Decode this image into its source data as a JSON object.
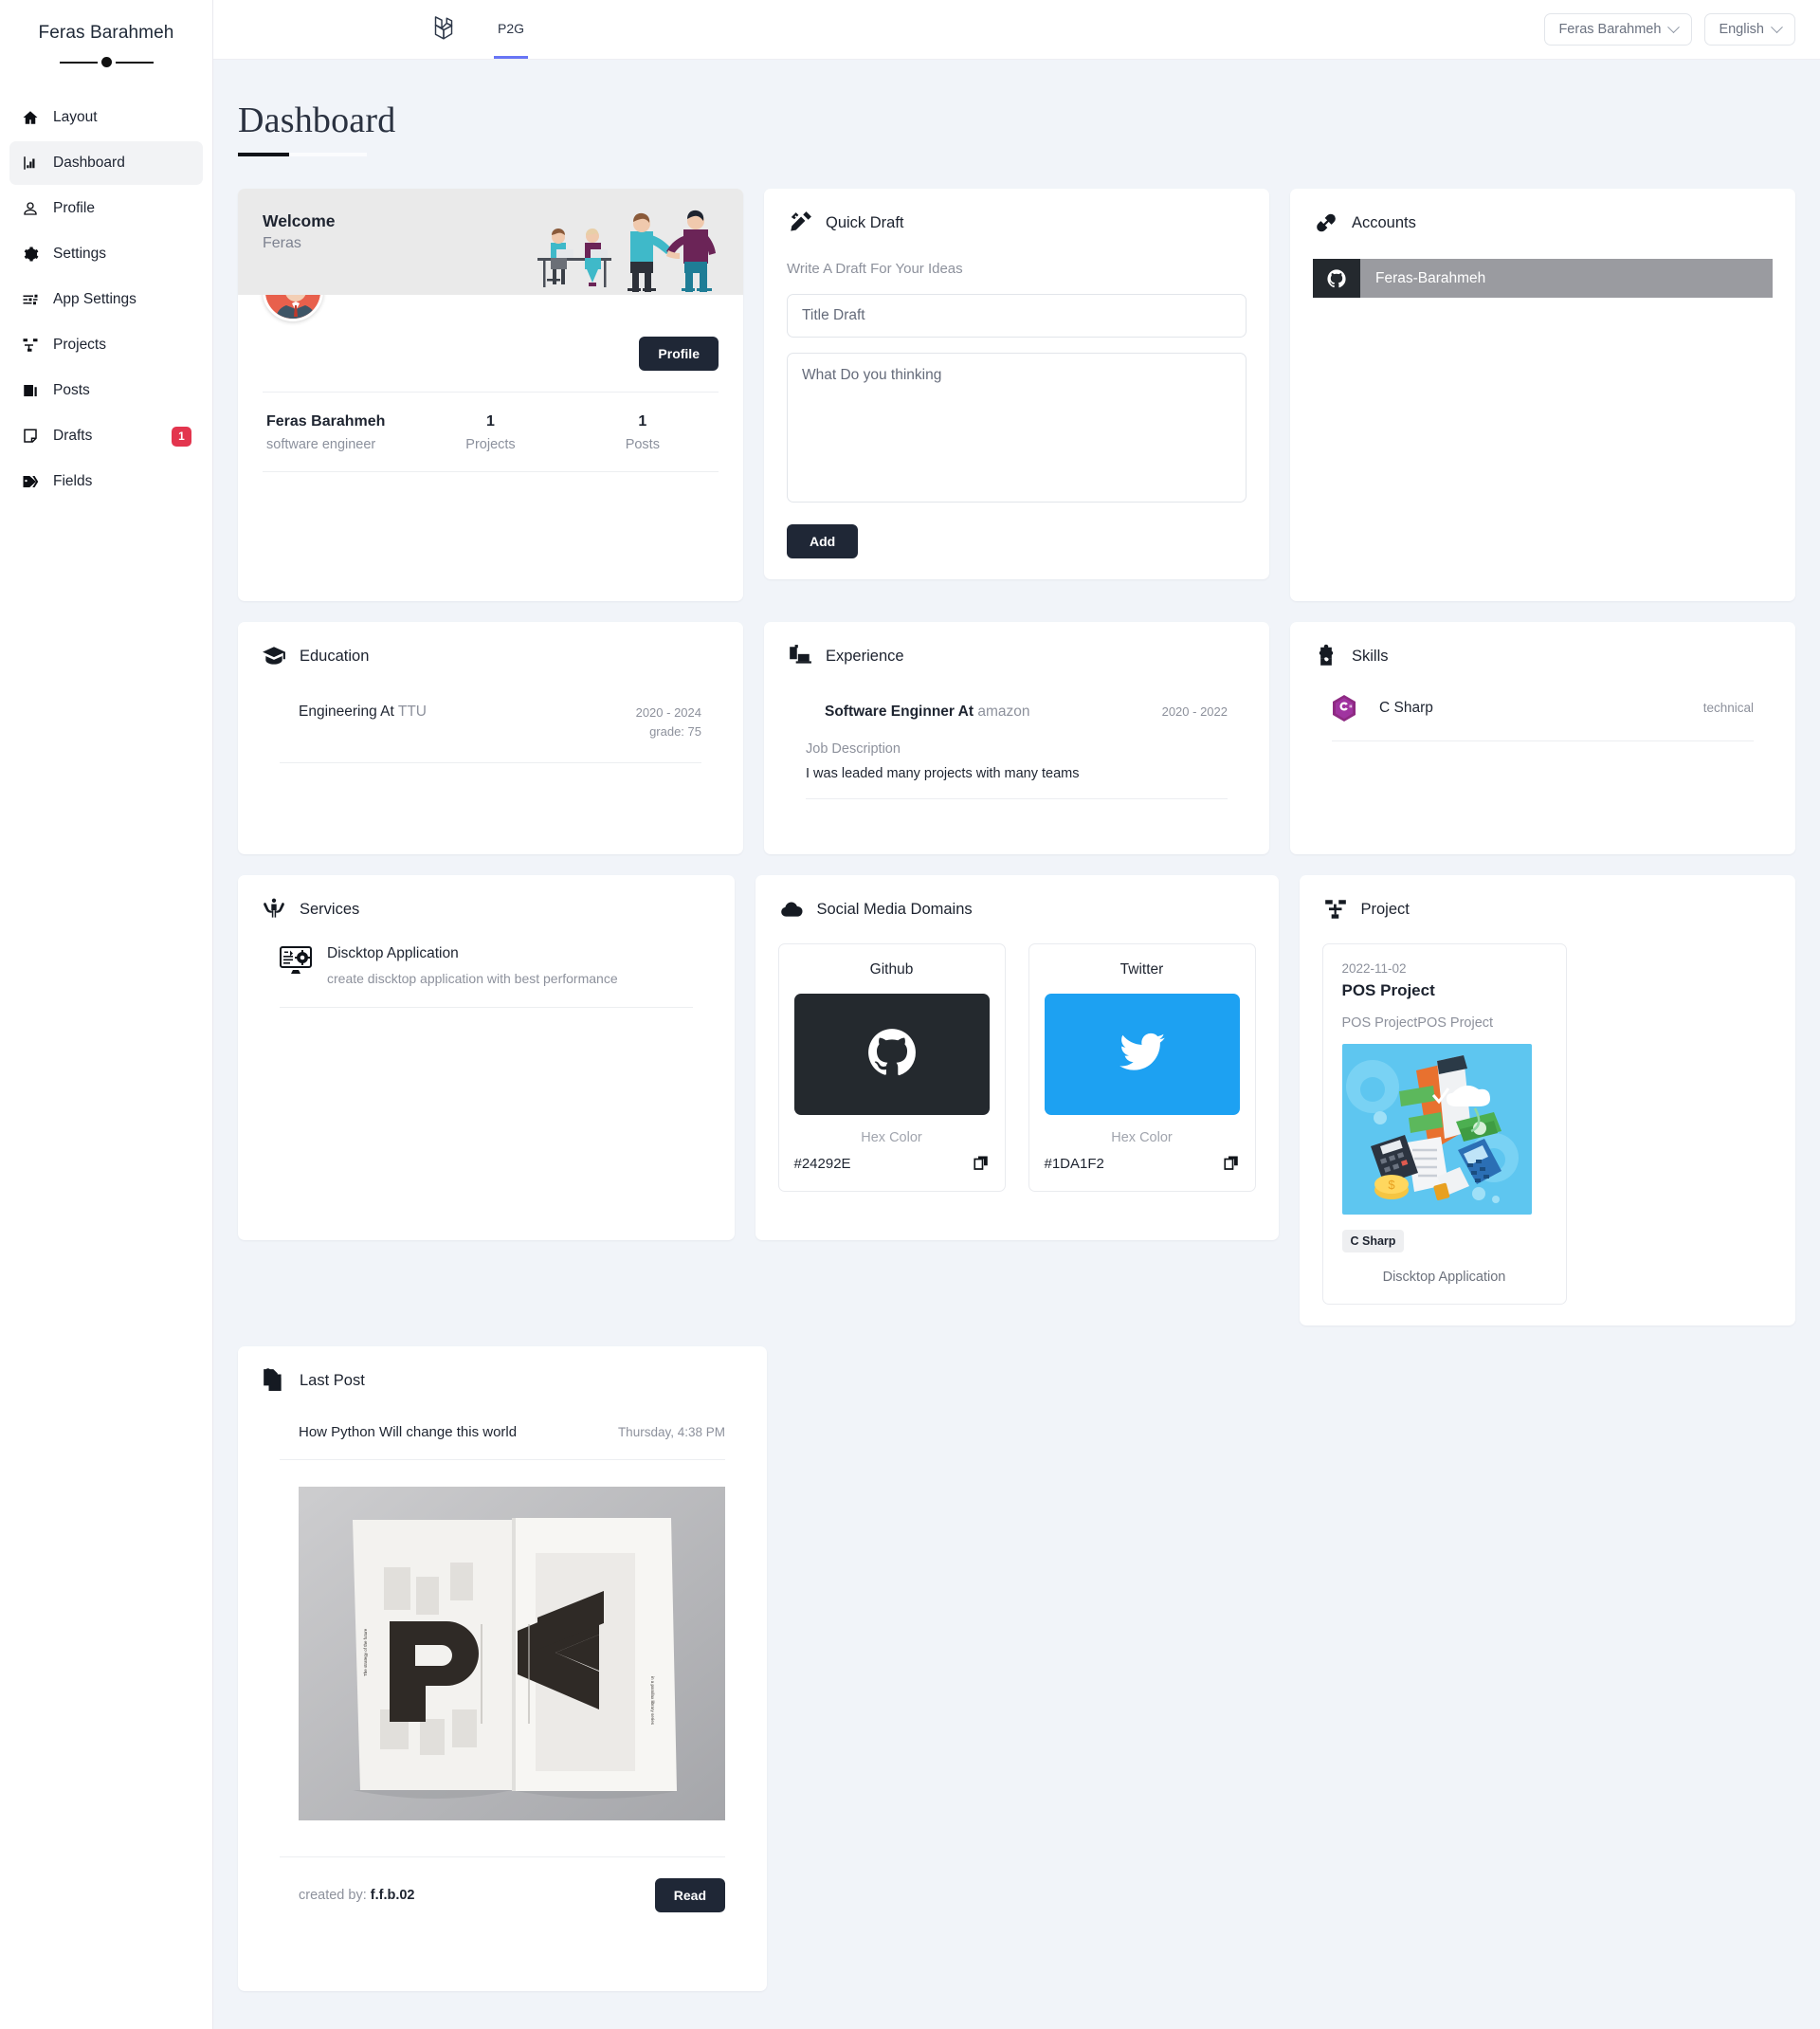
{
  "sidebar": {
    "brand": "Feras Barahmeh",
    "items": [
      {
        "label": "Layout",
        "icon": "home-icon",
        "badge": null
      },
      {
        "label": "Dashboard",
        "icon": "chart-icon",
        "badge": null
      },
      {
        "label": "Profile",
        "icon": "user-icon",
        "badge": null
      },
      {
        "label": "Settings",
        "icon": "gear-icon",
        "badge": null
      },
      {
        "label": "App Settings",
        "icon": "sliders-icon",
        "badge": null
      },
      {
        "label": "Projects",
        "icon": "sitemap-icon",
        "badge": null
      },
      {
        "label": "Posts",
        "icon": "newspaper-icon",
        "badge": null
      },
      {
        "label": "Drafts",
        "icon": "note-icon",
        "badge": "1"
      },
      {
        "label": "Fields",
        "icon": "tags-icon",
        "badge": null
      }
    ]
  },
  "topbar": {
    "logo": "laravel-logo",
    "tab": "P2G",
    "user_menu": "Feras Barahmeh",
    "language_menu": "English"
  },
  "page": {
    "title": "Dashboard"
  },
  "welcome": {
    "heading": "Welcome",
    "name": "Feras",
    "profile_button": "Profile",
    "stats": [
      {
        "top": "Feras Barahmeh",
        "bottom": "software engineer"
      },
      {
        "top": "1",
        "bottom": "Projects"
      },
      {
        "top": "1",
        "bottom": "Posts"
      }
    ]
  },
  "quick_draft": {
    "title": "Quick Draft",
    "icon": "pencil-ruler-icon",
    "subtitle": "Write A Draft For Your Ideas",
    "title_placeholder": "Title Draft",
    "title_value": "",
    "body_placeholder": "What Do you thinking",
    "body_value": "",
    "add_button": "Add"
  },
  "accounts": {
    "title": "Accounts",
    "icon": "link-icon",
    "rows": [
      {
        "icon": "github-icon",
        "name": "Feras-Barahmeh"
      }
    ]
  },
  "education": {
    "title": "Education",
    "icon": "graduation-cap-icon",
    "rows": [
      {
        "degree": "Engineering At ",
        "school": "TTU",
        "years": "2020 - 2024",
        "grade": "grade: 75"
      }
    ]
  },
  "experience": {
    "title": "Experience",
    "icon": "briefcase-icon",
    "rows": [
      {
        "position": "Software Enginner At ",
        "company": "amazon",
        "years": "2020 - 2022",
        "description_label": "Job Description",
        "description": "I was leaded many projects with many teams"
      }
    ]
  },
  "skills": {
    "title": "Skills",
    "icon": "puzzle-icon",
    "rows": [
      {
        "icon": "csharp-icon",
        "name": "C Sharp",
        "tag": "technical"
      }
    ]
  },
  "services": {
    "title": "Services",
    "icon": "hands-helping-icon",
    "rows": [
      {
        "icon": "desktop-cog-icon",
        "name": "Discktop Application",
        "desc": "create discktop application with best performance"
      }
    ]
  },
  "social": {
    "title": "Social Media Domains",
    "icon": "cloud-icon",
    "hex_label": "Hex Color",
    "copy_icon": "copy-icon",
    "items": [
      {
        "name": "Github",
        "icon": "github-icon",
        "hex": "#24292E"
      },
      {
        "name": "Twitter",
        "icon": "twitter-icon",
        "hex": "#1DA1F2"
      }
    ]
  },
  "project": {
    "title": "Project",
    "icon": "sitemap-icon",
    "items": [
      {
        "date": "2022-11-02",
        "name": "POS Project",
        "description": "POS ProjectPOS Project",
        "tag": "C Sharp",
        "footer": "Discktop Application"
      }
    ]
  },
  "last_post": {
    "title": "Last Post",
    "icon": "copy-docs-icon",
    "post_title": "How Python Will change this world",
    "post_date": "Thursday, 4:38 PM",
    "created_by_label": "created by: ",
    "created_by": "f.f.b.02",
    "read_button": "Read"
  }
}
